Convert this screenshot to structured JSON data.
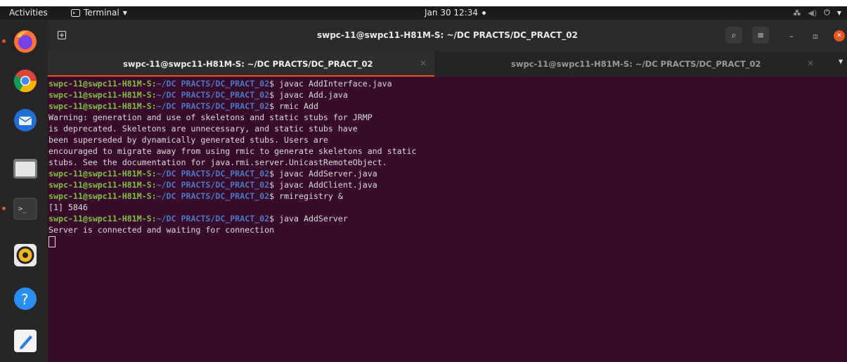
{
  "topbar": {
    "activities": "Activities",
    "app_name": "Terminal",
    "clock": "Jan 30  12:34"
  },
  "dock": {
    "items": [
      "firefox",
      "chrome",
      "thunderbird",
      "files",
      "terminal",
      "rhythmbox",
      "help",
      "text-editor"
    ]
  },
  "window": {
    "title": "swpc-11@swpc11-H81M-S: ~/DC PRACTS/DC_PRACT_02",
    "tabs": [
      {
        "label": "swpc-11@swpc11-H81M-S: ~/DC PRACTS/DC_PRACT_02",
        "active": true
      },
      {
        "label": "swpc-11@swpc11-H81M-S: ~/DC PRACTS/DC_PRACT_02",
        "active": false
      }
    ]
  },
  "terminal": {
    "prompt_user": "swpc-11@swpc11-H81M-S",
    "prompt_path": "~/DC PRACTS/DC_PRACT_02",
    "lines": [
      {
        "type": "cmd",
        "cmd": "javac AddInterface.java"
      },
      {
        "type": "cmd",
        "cmd": "javac Add.java"
      },
      {
        "type": "cmd",
        "cmd": "rmic Add"
      },
      {
        "type": "out",
        "text": "Warning: generation and use of skeletons and static stubs for JRMP"
      },
      {
        "type": "out",
        "text": "is deprecated. Skeletons are unnecessary, and static stubs have"
      },
      {
        "type": "out",
        "text": "been superseded by dynamically generated stubs. Users are"
      },
      {
        "type": "out",
        "text": "encouraged to migrate away from using rmic to generate skeletons and static"
      },
      {
        "type": "out",
        "text": "stubs. See the documentation for java.rmi.server.UnicastRemoteObject."
      },
      {
        "type": "cmd",
        "cmd": "javac AddServer.java"
      },
      {
        "type": "cmd",
        "cmd": "javac AddClient.java"
      },
      {
        "type": "cmd",
        "cmd": "rmiregistry &"
      },
      {
        "type": "out",
        "text": "[1] 5846"
      },
      {
        "type": "cmd",
        "cmd": "java AddServer"
      },
      {
        "type": "out",
        "text": "Server is connected and waiting for connection"
      }
    ]
  },
  "colors": {
    "terminal_bg": "#380c2a",
    "prompt_user": "#7fc243",
    "prompt_path": "#4d79c7",
    "accent": "#e95420"
  }
}
